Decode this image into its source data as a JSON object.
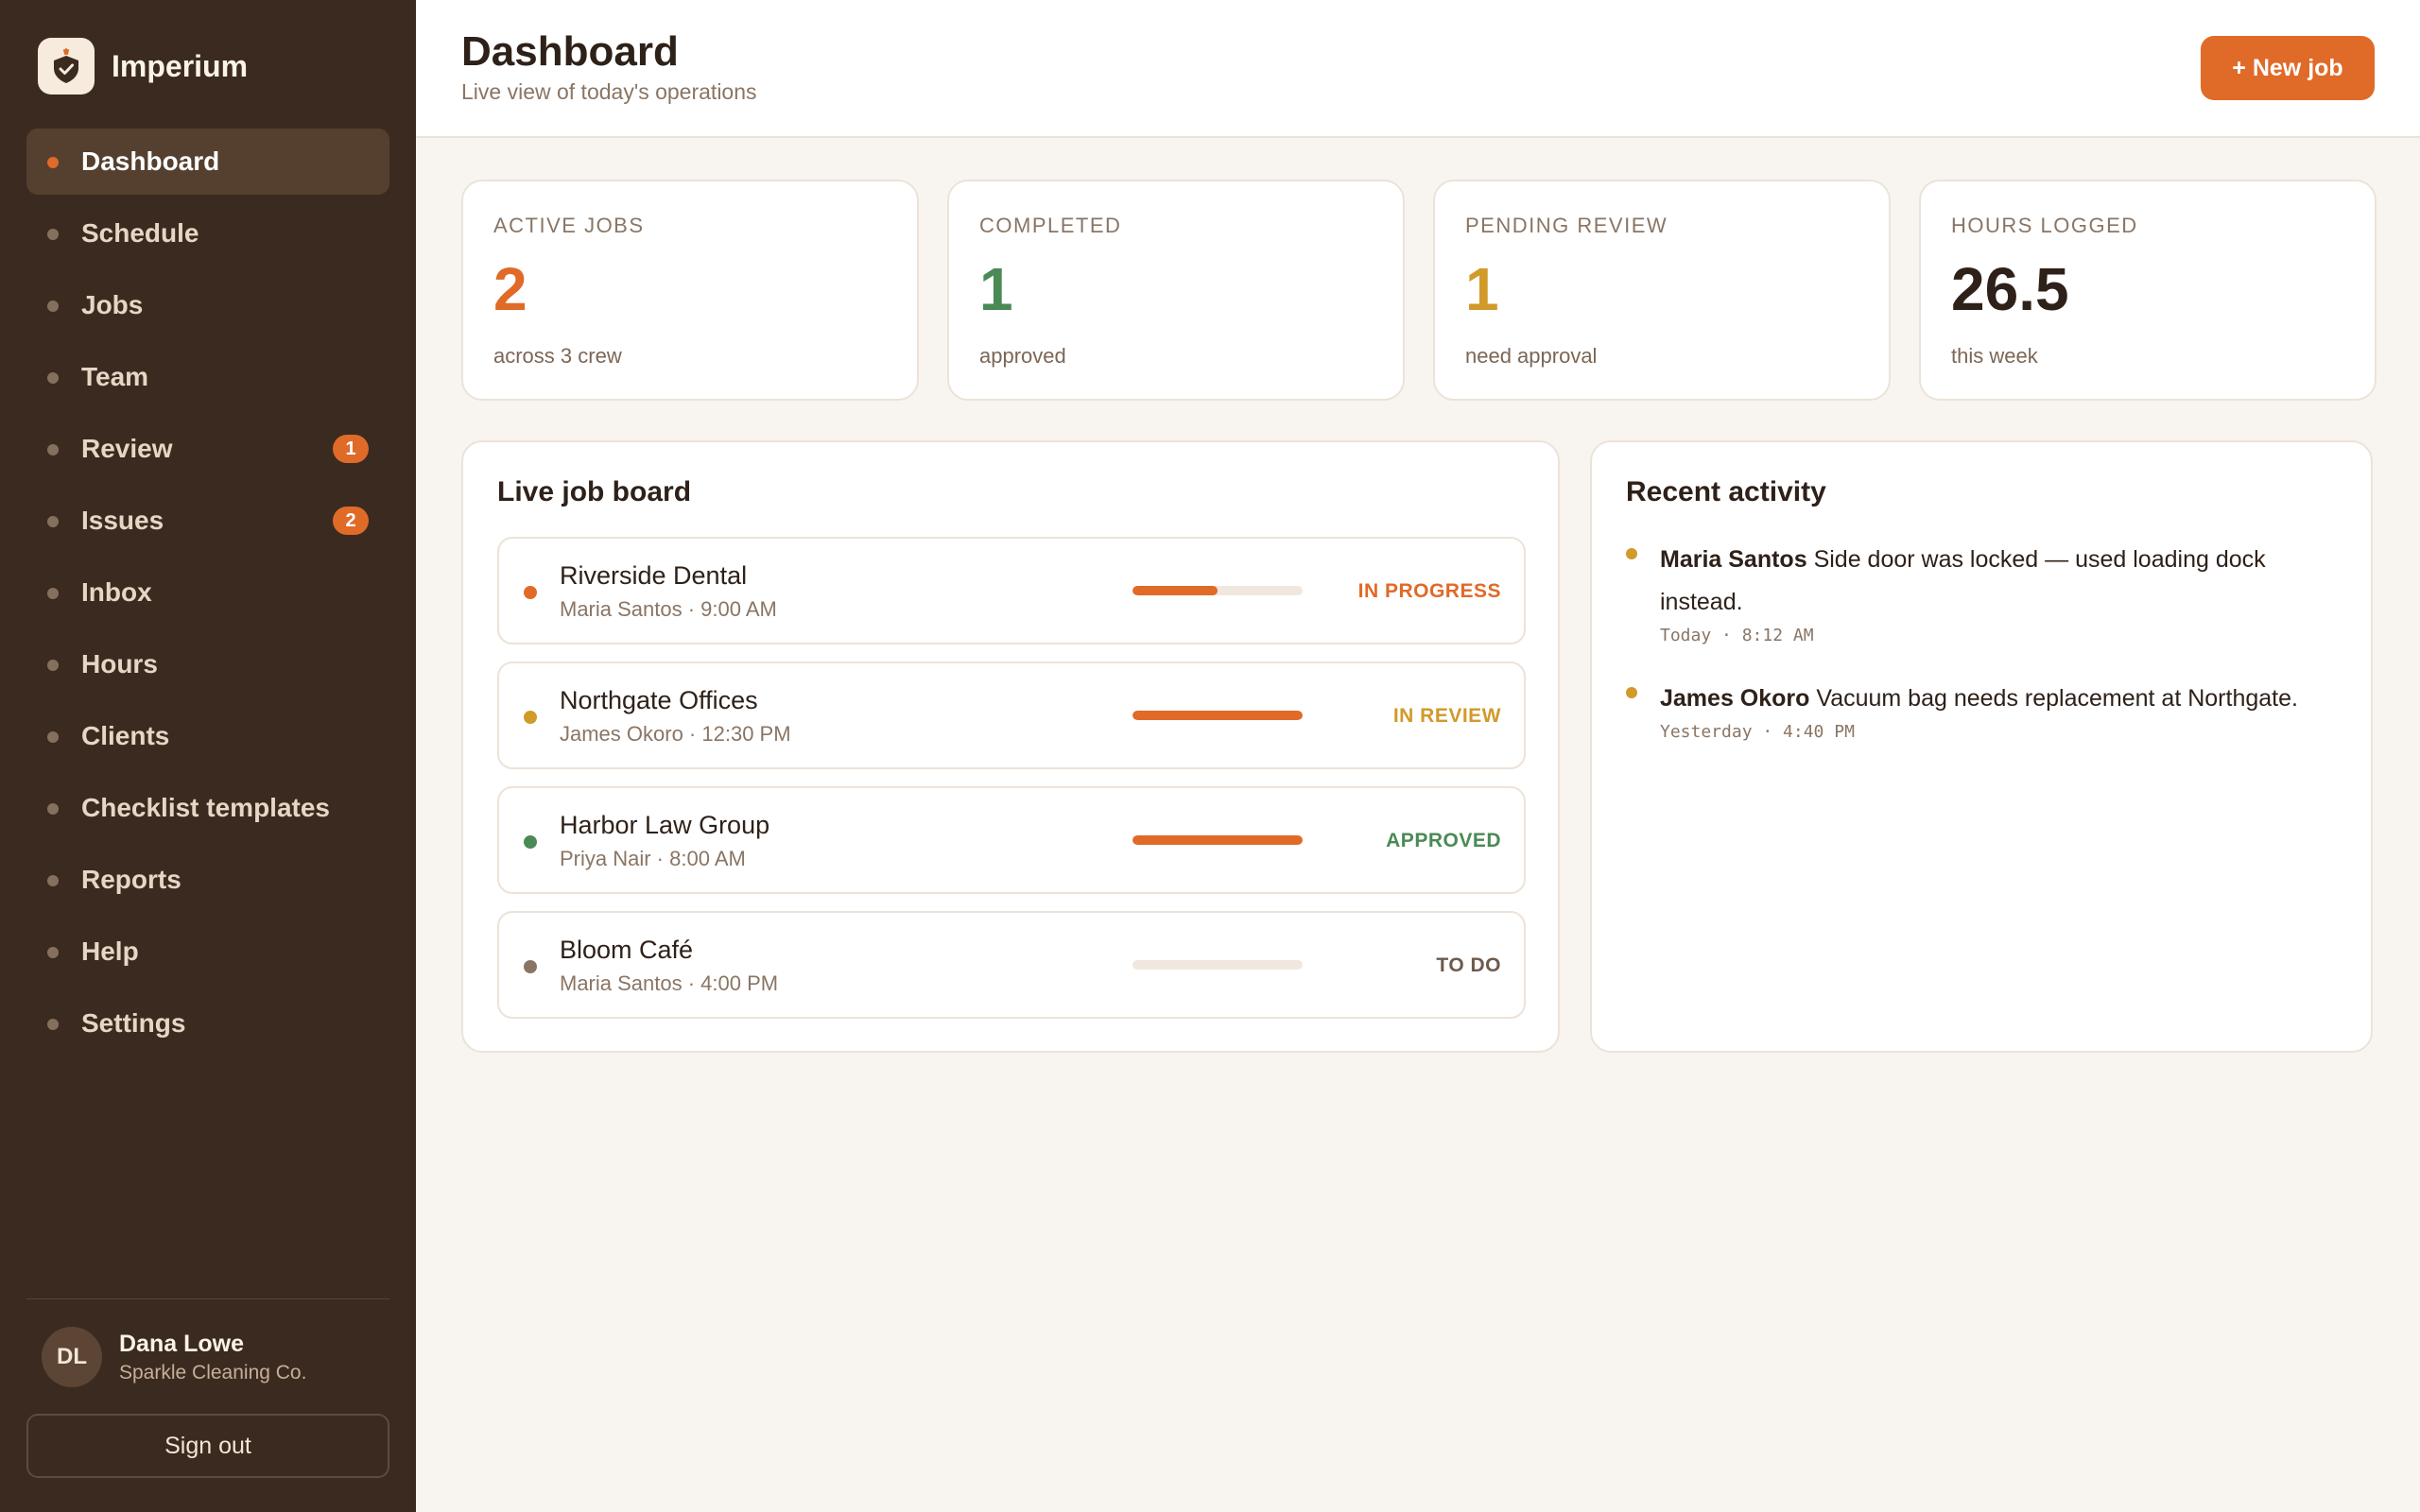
{
  "app": {
    "name": "Imperium"
  },
  "sidebar": {
    "items": [
      {
        "label": "Dashboard",
        "active": true
      },
      {
        "label": "Schedule"
      },
      {
        "label": "Jobs"
      },
      {
        "label": "Team"
      },
      {
        "label": "Review",
        "badge": "1"
      },
      {
        "label": "Issues",
        "badge": "2"
      },
      {
        "label": "Inbox"
      },
      {
        "label": "Hours"
      },
      {
        "label": "Clients"
      },
      {
        "label": "Checklist templates"
      },
      {
        "label": "Reports"
      },
      {
        "label": "Help"
      },
      {
        "label": "Settings"
      }
    ],
    "user": {
      "initials": "DL",
      "name": "Dana Lowe",
      "org": "Sparkle Cleaning Co."
    },
    "signout_label": "Sign out"
  },
  "header": {
    "title": "Dashboard",
    "subtitle": "Live view of today's operations",
    "new_job_label": "+ New job"
  },
  "stats": [
    {
      "label": "ACTIVE JOBS",
      "value": "2",
      "note": "across 3 crew",
      "color": "#e06a28"
    },
    {
      "label": "COMPLETED",
      "value": "1",
      "note": "approved",
      "color": "#4a8a55"
    },
    {
      "label": "PENDING REVIEW",
      "value": "1",
      "note": "need approval",
      "color": "#d19a2a"
    },
    {
      "label": "HOURS LOGGED",
      "value": "26.5",
      "note": "this week",
      "color": "#2e2119"
    }
  ],
  "job_board": {
    "title": "Live job board",
    "jobs": [
      {
        "name": "Riverside Dental",
        "meta": "Maria Santos · 9:00 AM",
        "status": "IN PROGRESS",
        "progress": 0.5,
        "dot_color": "#e06a28",
        "status_color": "#e06a28"
      },
      {
        "name": "Northgate Offices",
        "meta": "James Okoro · 12:30 PM",
        "status": "IN REVIEW",
        "progress": 1.0,
        "dot_color": "#d19a2a",
        "status_color": "#d19a2a"
      },
      {
        "name": "Harbor Law Group",
        "meta": "Priya Nair · 8:00 AM",
        "status": "APPROVED",
        "progress": 1.0,
        "dot_color": "#4a8a55",
        "status_color": "#4a8a55"
      },
      {
        "name": "Bloom Café",
        "meta": "Maria Santos · 4:00 PM",
        "status": "TO DO",
        "progress": 0,
        "dot_color": "#8a7564",
        "status_color": "#6e5a4b"
      }
    ]
  },
  "activity": {
    "title": "Recent activity",
    "items": [
      {
        "name": "Maria Santos",
        "text": "Side door was locked — used loading dock instead.",
        "time": "Today · 8:12 AM"
      },
      {
        "name": "James Okoro",
        "text": "Vacuum bag needs replacement at Northgate.",
        "time": "Yesterday · 4:40 PM"
      }
    ]
  }
}
